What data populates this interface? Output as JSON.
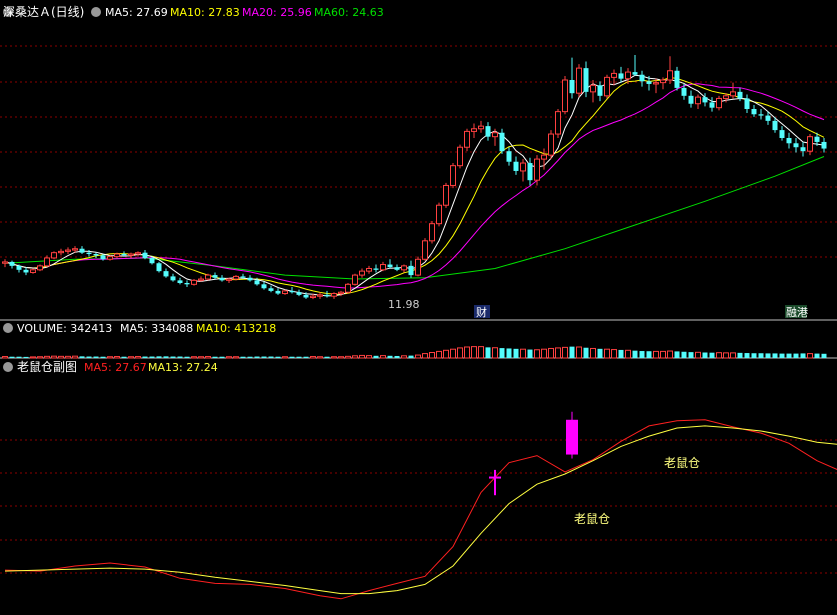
{
  "colors": {
    "background": "#000000",
    "grid": "#8b0000",
    "separator": "#c0c0c0",
    "up": "#ff4040",
    "down": "#54fcfc",
    "ma5": "#ffffff",
    "ma10": "#ffff00",
    "ma20": "#ff00ff",
    "ma60": "#00e000",
    "osc_ma5": "#ff2020",
    "osc_ma13": "#ffff40",
    "signal": "#ff00ff",
    "annotation": "#ffff80"
  },
  "price_panel": {
    "stock_name": "深桑达Ａ",
    "period": "(日线)",
    "ma5_label": "MA5: 27.69",
    "ma10_label": "MA10: 27.83",
    "ma20_label": "MA20: 25.96",
    "ma60_label": "MA60: 24.63",
    "low_mark": "11.98",
    "badge_cai": "财",
    "badge_tui": "融港"
  },
  "volume_panel": {
    "volume_label": "VOLUME: 342413",
    "ma5_label": "MA5: 334088",
    "ma10_label": "MA10: 413218"
  },
  "osc_panel": {
    "title": "老鼠仓副图",
    "ma5_label": "MA5: 27.67",
    "ma13_label": "MA13: 27.24",
    "signal_label_1": "老鼠仓",
    "signal_label_2": "老鼠仓"
  },
  "icons": {
    "collapse": "circle-chevron-down-icon"
  },
  "chart_data": [
    {
      "type": "candlestick",
      "title": "深桑达Ａ (日线)",
      "ylim": [
        11,
        33
      ],
      "grid": true,
      "candles": [
        [
          14.7,
          15.0,
          14.4,
          14.8
        ],
        [
          14.8,
          14.9,
          14.3,
          14.5
        ],
        [
          14.5,
          14.6,
          14.0,
          14.2
        ],
        [
          14.2,
          14.4,
          13.8,
          14.0
        ],
        [
          14.0,
          14.3,
          13.9,
          14.2
        ],
        [
          14.2,
          14.6,
          14.1,
          14.5
        ],
        [
          14.5,
          15.3,
          14.4,
          15.1
        ],
        [
          15.1,
          15.6,
          15.0,
          15.5
        ],
        [
          15.5,
          15.8,
          15.3,
          15.6
        ],
        [
          15.6,
          15.9,
          15.4,
          15.7
        ],
        [
          15.7,
          16.0,
          15.5,
          15.8
        ],
        [
          15.8,
          16.0,
          15.4,
          15.5
        ],
        [
          15.5,
          15.7,
          15.2,
          15.4
        ],
        [
          15.4,
          15.5,
          15.1,
          15.3
        ],
        [
          15.3,
          15.4,
          14.9,
          15.0
        ],
        [
          15.0,
          15.3,
          14.9,
          15.2
        ],
        [
          15.2,
          15.5,
          15.1,
          15.4
        ],
        [
          15.4,
          15.6,
          15.2,
          15.3
        ],
        [
          15.3,
          15.5,
          15.1,
          15.4
        ],
        [
          15.4,
          15.6,
          15.2,
          15.5
        ],
        [
          15.5,
          15.7,
          15.0,
          15.1
        ],
        [
          15.1,
          15.2,
          14.6,
          14.7
        ],
        [
          14.7,
          14.8,
          14.0,
          14.1
        ],
        [
          14.1,
          14.3,
          13.6,
          13.7
        ],
        [
          13.7,
          13.9,
          13.3,
          13.4
        ],
        [
          13.4,
          13.6,
          13.1,
          13.2
        ],
        [
          13.2,
          13.4,
          12.9,
          13.1
        ],
        [
          13.1,
          13.5,
          13.0,
          13.4
        ],
        [
          13.4,
          13.7,
          13.3,
          13.5
        ],
        [
          13.5,
          13.9,
          13.4,
          13.8
        ],
        [
          13.8,
          14.0,
          13.5,
          13.6
        ],
        [
          13.6,
          13.8,
          13.3,
          13.4
        ],
        [
          13.4,
          13.6,
          13.2,
          13.5
        ],
        [
          13.5,
          13.8,
          13.4,
          13.7
        ],
        [
          13.7,
          13.9,
          13.5,
          13.6
        ],
        [
          13.6,
          13.8,
          13.3,
          13.4
        ],
        [
          13.4,
          13.6,
          13.0,
          13.1
        ],
        [
          13.1,
          13.3,
          12.7,
          12.8
        ],
        [
          12.8,
          13.0,
          12.5,
          12.6
        ],
        [
          12.6,
          12.8,
          12.3,
          12.4
        ],
        [
          12.4,
          12.7,
          12.3,
          12.6
        ],
        [
          12.6,
          12.9,
          12.4,
          12.5
        ],
        [
          12.5,
          12.7,
          12.2,
          12.3
        ],
        [
          12.3,
          12.5,
          12.0,
          12.1
        ],
        [
          12.1,
          12.4,
          11.98,
          12.2
        ],
        [
          12.2,
          12.5,
          12.0,
          12.3
        ],
        [
          12.3,
          12.6,
          12.1,
          12.2
        ],
        [
          12.2,
          12.5,
          12.0,
          12.4
        ],
        [
          12.4,
          12.6,
          12.2,
          12.5
        ],
        [
          12.5,
          13.2,
          12.4,
          13.1
        ],
        [
          13.1,
          13.9,
          13.0,
          13.8
        ],
        [
          13.8,
          14.3,
          13.6,
          14.1
        ],
        [
          14.1,
          14.5,
          13.9,
          14.3
        ],
        [
          14.3,
          14.6,
          14.0,
          14.2
        ],
        [
          14.2,
          14.8,
          14.1,
          14.6
        ],
        [
          14.6,
          15.0,
          14.3,
          14.4
        ],
        [
          14.4,
          14.6,
          14.1,
          14.2
        ],
        [
          14.2,
          14.6,
          14.0,
          14.5
        ],
        [
          14.5,
          14.9,
          13.6,
          13.8
        ],
        [
          13.8,
          15.2,
          13.7,
          15.0
        ],
        [
          15.0,
          16.6,
          14.9,
          16.4
        ],
        [
          16.4,
          17.9,
          16.2,
          17.7
        ],
        [
          17.7,
          19.3,
          17.5,
          19.1
        ],
        [
          19.1,
          20.8,
          18.9,
          20.6
        ],
        [
          20.6,
          22.3,
          20.4,
          22.1
        ],
        [
          22.1,
          23.7,
          21.9,
          23.5
        ],
        [
          23.5,
          24.9,
          23.2,
          24.7
        ],
        [
          24.7,
          25.3,
          24.2,
          24.9
        ],
        [
          24.9,
          25.5,
          24.6,
          25.1
        ],
        [
          25.1,
          25.4,
          24.0,
          24.3
        ],
        [
          24.3,
          24.9,
          23.6,
          24.6
        ],
        [
          24.6,
          24.9,
          23.0,
          23.2
        ],
        [
          23.2,
          23.5,
          22.1,
          22.4
        ],
        [
          22.4,
          22.8,
          21.4,
          21.7
        ],
        [
          21.7,
          22.6,
          20.9,
          22.3
        ],
        [
          22.3,
          22.7,
          20.6,
          21.0
        ],
        [
          21.0,
          22.9,
          20.6,
          22.6
        ],
        [
          22.6,
          23.4,
          21.8,
          22.9
        ],
        [
          22.9,
          24.8,
          22.6,
          24.5
        ],
        [
          24.5,
          26.4,
          24.2,
          26.2
        ],
        [
          26.2,
          28.9,
          26.0,
          28.6
        ],
        [
          28.6,
          30.3,
          27.2,
          27.6
        ],
        [
          27.6,
          29.8,
          27.3,
          29.5
        ],
        [
          29.5,
          30.0,
          27.3,
          27.7
        ],
        [
          27.7,
          28.6,
          26.9,
          28.2
        ],
        [
          28.2,
          28.5,
          27.0,
          27.4
        ],
        [
          27.4,
          29.0,
          27.2,
          28.8
        ],
        [
          28.8,
          29.4,
          28.2,
          29.1
        ],
        [
          29.1,
          29.6,
          28.4,
          28.7
        ],
        [
          28.7,
          29.5,
          28.3,
          29.2
        ],
        [
          29.2,
          30.5,
          28.9,
          29.0
        ],
        [
          29.0,
          29.3,
          28.1,
          28.5
        ],
        [
          28.5,
          28.9,
          27.8,
          28.3
        ],
        [
          28.3,
          28.7,
          27.6,
          28.4
        ],
        [
          28.4,
          28.8,
          27.9,
          28.6
        ],
        [
          28.6,
          30.4,
          28.3,
          29.3
        ],
        [
          29.3,
          29.6,
          27.8,
          28.0
        ],
        [
          28.0,
          28.3,
          27.1,
          27.4
        ],
        [
          27.4,
          27.8,
          26.5,
          26.8
        ],
        [
          26.8,
          27.5,
          26.4,
          27.3
        ],
        [
          27.3,
          27.6,
          26.6,
          26.9
        ],
        [
          26.9,
          27.3,
          26.2,
          26.5
        ],
        [
          26.5,
          27.4,
          26.3,
          27.2
        ],
        [
          27.2,
          27.6,
          26.9,
          27.4
        ],
        [
          27.4,
          28.4,
          27.2,
          27.7
        ],
        [
          27.7,
          28.0,
          27.0,
          27.2
        ],
        [
          27.2,
          27.5,
          26.1,
          26.4
        ],
        [
          26.4,
          26.7,
          25.8,
          26.0
        ],
        [
          26.0,
          26.4,
          25.6,
          25.9
        ],
        [
          25.9,
          26.2,
          25.2,
          25.5
        ],
        [
          25.5,
          25.8,
          24.6,
          24.8
        ],
        [
          24.8,
          25.1,
          24.0,
          24.2
        ],
        [
          24.2,
          24.6,
          23.4,
          23.8
        ],
        [
          23.8,
          24.2,
          23.1,
          23.5
        ],
        [
          23.5,
          23.9,
          22.8,
          23.2
        ],
        [
          23.2,
          24.5,
          22.9,
          24.3
        ],
        [
          24.3,
          24.6,
          23.6,
          23.9
        ],
        [
          23.9,
          24.2,
          23.1,
          23.4
        ]
      ],
      "ma60": [
        [
          0,
          14.7
        ],
        [
          10,
          15.0
        ],
        [
          20,
          15.1
        ],
        [
          30,
          14.5
        ],
        [
          40,
          13.8
        ],
        [
          50,
          13.5
        ],
        [
          60,
          13.6
        ],
        [
          70,
          14.3
        ],
        [
          80,
          15.8
        ],
        [
          90,
          17.6
        ],
        [
          100,
          19.4
        ],
        [
          110,
          21.3
        ],
        [
          117,
          22.8
        ]
      ],
      "volumes": [
        8,
        7,
        7,
        6,
        6,
        7,
        9,
        10,
        9,
        9,
        10,
        9,
        8,
        8,
        7,
        7,
        8,
        7,
        7,
        8,
        8,
        8,
        9,
        9,
        8,
        8,
        7,
        7,
        7,
        8,
        7,
        7,
        7,
        7,
        7,
        7,
        8,
        8,
        8,
        7,
        7,
        7,
        7,
        7,
        8,
        7,
        7,
        7,
        7,
        9,
        12,
        14,
        13,
        12,
        13,
        12,
        11,
        12,
        13,
        16,
        24,
        30,
        36,
        42,
        48,
        55,
        60,
        62,
        62,
        58,
        56,
        54,
        52,
        50,
        48,
        46,
        45,
        48,
        52,
        55,
        58,
        62,
        60,
        56,
        52,
        50,
        48,
        46,
        44,
        42,
        40,
        38,
        37,
        36,
        36,
        38,
        36,
        34,
        32,
        31,
        30,
        29,
        29,
        28,
        28,
        28,
        27,
        26,
        26,
        25,
        25,
        24,
        24,
        24,
        25,
        24,
        24,
        23
      ]
    },
    {
      "type": "line",
      "title": "老鼠仓副图",
      "ylim": [
        11,
        33
      ],
      "series": [
        {
          "name": "MA5",
          "points": [
            [
              0,
              14.9
            ],
            [
              5,
              14.8
            ],
            [
              10,
              15.3
            ],
            [
              15,
              15.6
            ],
            [
              20,
              15.2
            ],
            [
              25,
              14.1
            ],
            [
              30,
              13.6
            ],
            [
              35,
              13.5
            ],
            [
              40,
              13.1
            ],
            [
              45,
              12.4
            ],
            [
              48,
              12.1
            ],
            [
              52,
              12.9
            ],
            [
              56,
              13.6
            ],
            [
              60,
              14.3
            ],
            [
              64,
              17.2
            ],
            [
              68,
              22.5
            ],
            [
              72,
              25.4
            ],
            [
              76,
              26.1
            ],
            [
              80,
              24.5
            ],
            [
              84,
              25.7
            ],
            [
              88,
              27.5
            ],
            [
              92,
              29.0
            ],
            [
              96,
              29.5
            ],
            [
              100,
              29.6
            ],
            [
              104,
              28.9
            ],
            [
              108,
              28.3
            ],
            [
              112,
              27.3
            ],
            [
              116,
              25.6
            ],
            [
              119,
              24.7
            ]
          ]
        },
        {
          "name": "MA13",
          "points": [
            [
              0,
              14.8
            ],
            [
              5,
              14.9
            ],
            [
              10,
              15.0
            ],
            [
              15,
              15.1
            ],
            [
              20,
              15.0
            ],
            [
              25,
              14.7
            ],
            [
              30,
              14.2
            ],
            [
              35,
              13.8
            ],
            [
              40,
              13.4
            ],
            [
              45,
              12.9
            ],
            [
              48,
              12.6
            ],
            [
              52,
              12.6
            ],
            [
              56,
              12.9
            ],
            [
              60,
              13.5
            ],
            [
              64,
              15.3
            ],
            [
              68,
              18.5
            ],
            [
              72,
              21.4
            ],
            [
              76,
              23.3
            ],
            [
              80,
              24.3
            ],
            [
              84,
              25.6
            ],
            [
              88,
              27.0
            ],
            [
              92,
              28.0
            ],
            [
              96,
              28.8
            ],
            [
              100,
              29.0
            ],
            [
              104,
              28.8
            ],
            [
              108,
              28.5
            ],
            [
              112,
              28.0
            ],
            [
              116,
              27.4
            ],
            [
              119,
              27.2
            ]
          ]
        }
      ],
      "signals": [
        {
          "x": 70,
          "low": 23.2,
          "high": 24.7,
          "label": "老鼠仓"
        },
        {
          "x": 81,
          "low": 26.2,
          "high": 29.6,
          "label": "老鼠仓"
        }
      ]
    }
  ]
}
